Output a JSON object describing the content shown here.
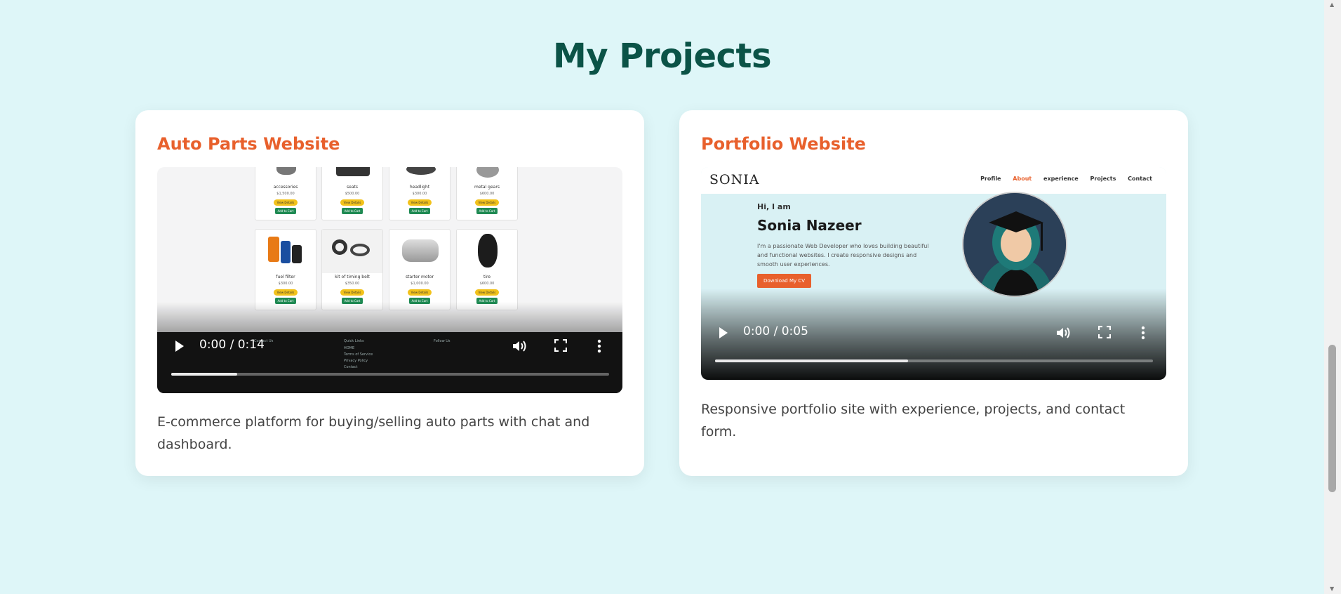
{
  "page": {
    "title": "My Projects"
  },
  "projects": [
    {
      "title": "Auto Parts Website",
      "description": "E-commerce platform for buying/selling auto parts with chat and dashboard.",
      "video": {
        "time": "0:00 / 0:14",
        "progress": 0.15,
        "products": [
          {
            "name": "accessories",
            "price": "$1,500.00"
          },
          {
            "name": "seats",
            "price": "$500.00"
          },
          {
            "name": "headlight",
            "price": "$300.00"
          },
          {
            "name": "metal gears",
            "price": "$600.00"
          },
          {
            "name": "fuel filter",
            "price": "$300.00"
          },
          {
            "name": "kit of timing belt",
            "price": "$350.00"
          },
          {
            "name": "starter motor",
            "price": "$1,000.00"
          },
          {
            "name": "tire",
            "price": "$600.00"
          }
        ],
        "view_details": "View Details",
        "add_to_cart": "Add to Cart",
        "footer": {
          "contact": "Contact Us",
          "quick_links": "Quick Links",
          "links": [
            "HOME",
            "Terms of Service",
            "Privacy Policy",
            "Contact"
          ],
          "follow": "Follow Us"
        }
      }
    },
    {
      "title": "Portfolio Website",
      "description": "Responsive portfolio site with experience, projects, and contact form.",
      "video": {
        "time": "0:00 / 0:05",
        "progress": 0.44,
        "logo": "SONIA",
        "nav": [
          "Profile",
          "About",
          "experience",
          "Projects",
          "Contact"
        ],
        "greeting": "Hi, I am",
        "name": "Sonia Nazeer",
        "intro": "I'm a passionate Web Developer who loves building beautiful and functional websites. I create responsive designs and smooth user experiences.",
        "cv_button": "Download My CV"
      }
    }
  ],
  "colors": {
    "background": "#def6f8",
    "heading": "#0b5347",
    "accent": "#e8602c"
  },
  "icons": [
    "play-icon",
    "volume-icon",
    "fullscreen-icon",
    "more-options-icon"
  ]
}
